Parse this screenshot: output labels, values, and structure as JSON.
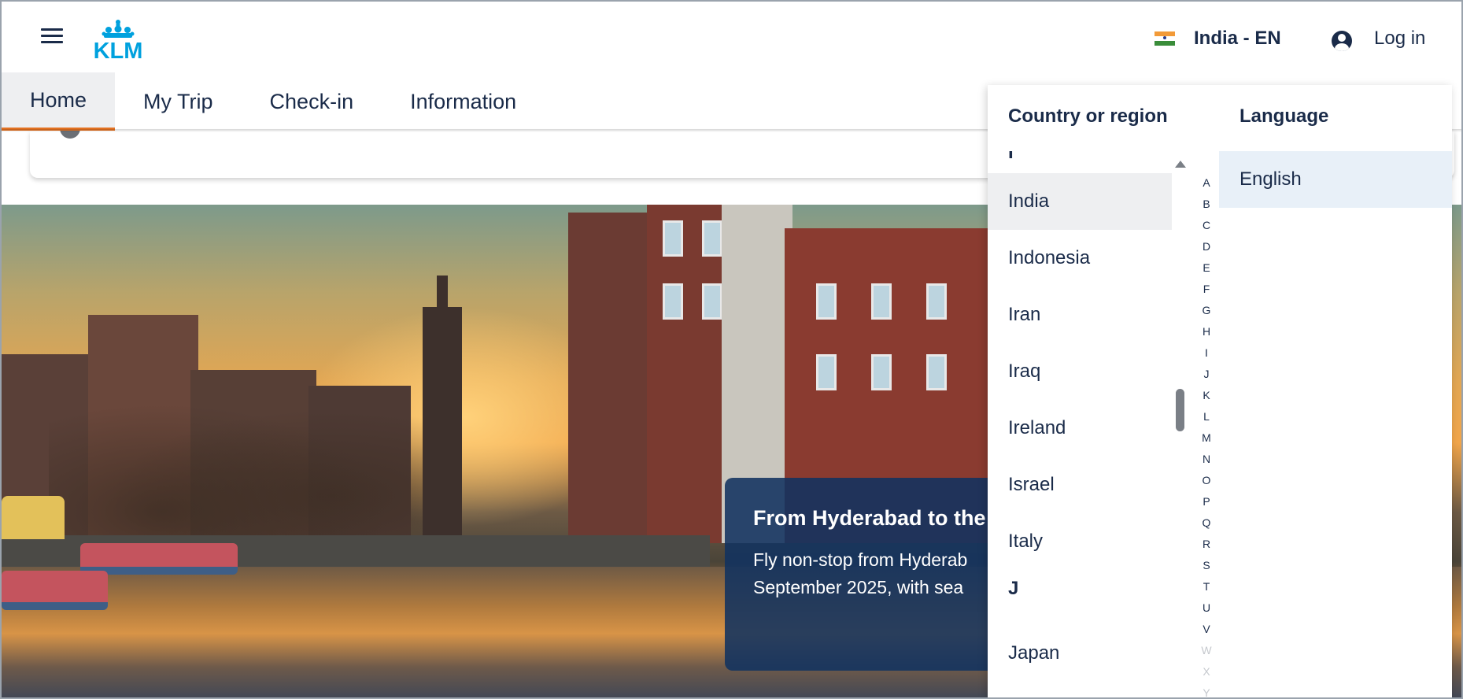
{
  "header": {
    "logo_text": "KLM",
    "locale_label": "India - EN",
    "login_label": "Log in"
  },
  "nav": {
    "tabs": [
      {
        "label": "Home",
        "active": true
      },
      {
        "label": "My Trip"
      },
      {
        "label": "Check-in"
      },
      {
        "label": "Information"
      }
    ]
  },
  "promo": {
    "title": "From Hyderabad to the",
    "line1": "Fly non-stop from Hyderab",
    "line2": "September 2025, with sea"
  },
  "locale_dropdown": {
    "country_heading": "Country or region",
    "language_heading": "Language",
    "letter_i": "I",
    "letter_j": "J",
    "countries_i": [
      "India",
      "Indonesia",
      "Iran",
      "Iraq",
      "Ireland",
      "Israel",
      "Italy"
    ],
    "countries_j": [
      "Japan"
    ],
    "selected_country": "India",
    "alphabet": [
      "A",
      "B",
      "C",
      "D",
      "E",
      "F",
      "G",
      "H",
      "I",
      "J",
      "K",
      "L",
      "M",
      "N",
      "O",
      "P",
      "Q",
      "R",
      "S",
      "T",
      "U",
      "V",
      "W",
      "X",
      "Y"
    ],
    "languages": [
      "English"
    ],
    "selected_language": "English"
  },
  "colors": {
    "brand_navy": "#1a2b49",
    "klm_blue": "#00a1de",
    "active_tab_underline": "#e37222",
    "promo_bg": "#113260"
  },
  "icons": [
    "hamburger-menu-icon",
    "klm-logo",
    "india-flag-icon",
    "user-account-icon",
    "scroll-up-icon"
  ]
}
